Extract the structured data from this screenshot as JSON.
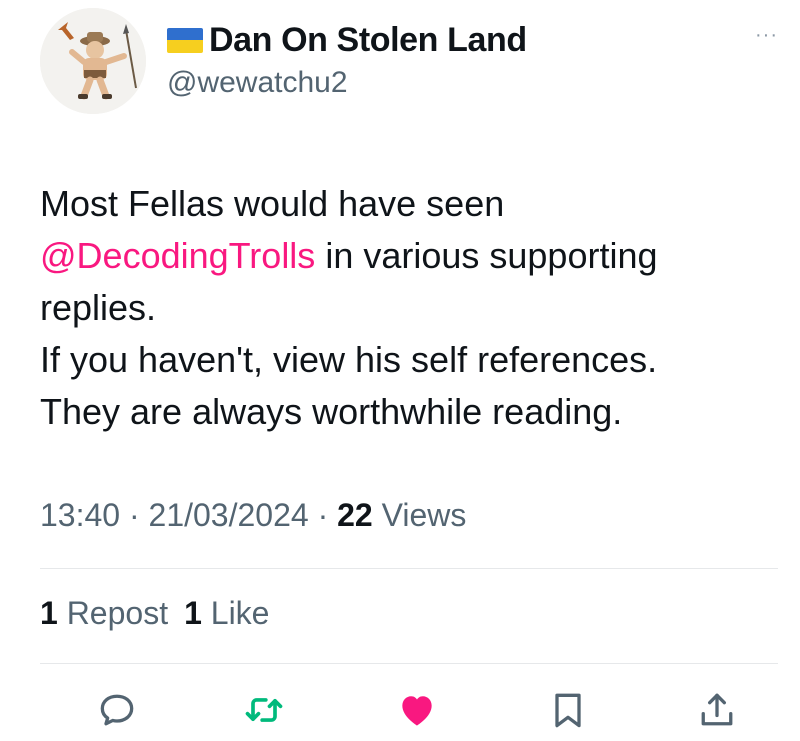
{
  "author": {
    "display_name": "Dan On Stolen Land",
    "handle": "@wewatchu2",
    "avatar_icon": "cartoon-hunter-avatar",
    "flag_icon": "ukraine-flag-icon"
  },
  "menu": {
    "more_label": "···"
  },
  "tweet": {
    "line1": "Most Fellas would have seen",
    "mention": "@DecodingTrolls",
    "line2_rest": " in various supporting replies.",
    "line3": "If you haven't, view his self references.",
    "line4": "They are always worthwhile reading."
  },
  "meta": {
    "time": "13:40",
    "sep1": " · ",
    "date": "21/03/2024",
    "sep2": " · ",
    "views_count": "22",
    "views_label": " Views"
  },
  "stats": {
    "reposts_count": "1",
    "reposts_label": " Repost",
    "likes_count": "1",
    "likes_label": " Like"
  },
  "actions": {
    "reply_icon": "reply-icon",
    "repost_icon": "repost-icon",
    "like_icon": "heart-icon",
    "bookmark_icon": "bookmark-icon",
    "share_icon": "share-icon"
  },
  "colors": {
    "mention": "#f91880",
    "repost_active": "#00ba7c",
    "like_active": "#f91880",
    "secondary_text": "#536471"
  }
}
